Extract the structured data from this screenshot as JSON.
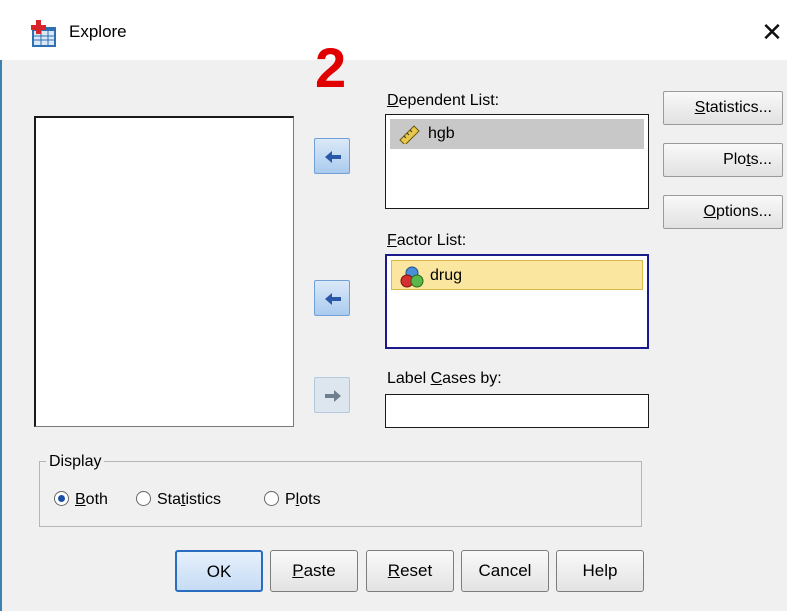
{
  "window": {
    "title": "Explore",
    "close_glyph": "✕"
  },
  "annotation": {
    "text": "2",
    "color": "#e00000"
  },
  "dependent_list": {
    "label_prefix": "",
    "label_ul": "D",
    "label_rest": "ependent List:",
    "items": [
      {
        "name": "hgb",
        "icon": "ruler-icon"
      }
    ]
  },
  "factor_list": {
    "label_ul": "F",
    "label_rest": "actor List:",
    "items": [
      {
        "name": "drug",
        "icon": "nominal-balls-icon"
      }
    ]
  },
  "label_cases": {
    "label_pre": "Label ",
    "label_ul": "C",
    "label_rest": "ases by:",
    "value": ""
  },
  "side_buttons": {
    "statistics": {
      "ul": "S",
      "rest": "tatistics..."
    },
    "plots": {
      "pre": "Plo",
      "ul": "t",
      "rest": "s..."
    },
    "options": {
      "ul": "O",
      "rest": "ptions..."
    }
  },
  "display": {
    "title": "Display",
    "options": [
      {
        "pre": "",
        "ul": "B",
        "rest": "oth",
        "selected": true
      },
      {
        "pre": "Sta",
        "ul": "t",
        "rest": "istics",
        "selected": false
      },
      {
        "pre": "P",
        "ul": "l",
        "rest": "ots",
        "selected": false
      }
    ]
  },
  "bottom_buttons": {
    "ok": "OK",
    "paste": {
      "ul": "P",
      "rest": "aste"
    },
    "reset": {
      "ul": "R",
      "rest": "eset"
    },
    "cancel": "Cancel",
    "help": "Help"
  },
  "colors": {
    "accent": "#2a6dc0",
    "dependent_selection": "#c8c8c8",
    "factor_selection": "#fbe6a0"
  }
}
